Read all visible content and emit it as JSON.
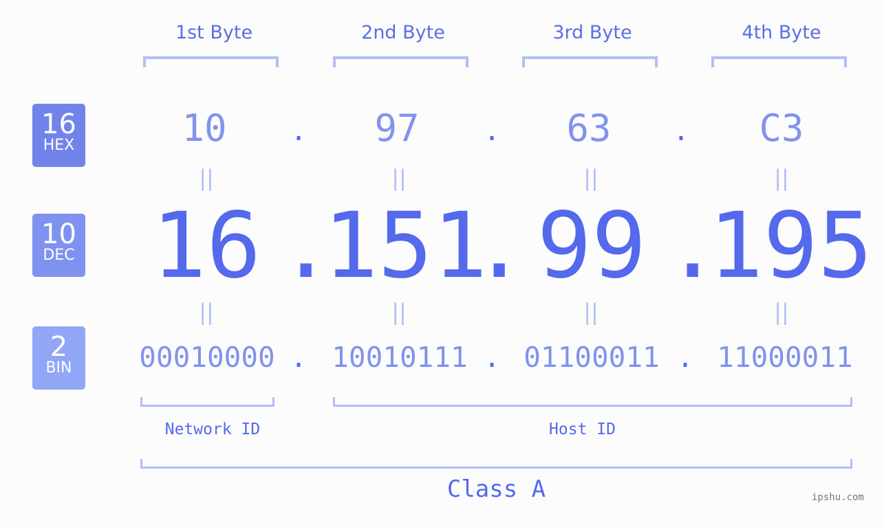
{
  "badges": {
    "hex": {
      "num": "16",
      "label": "HEX",
      "color": "#7283ea"
    },
    "dec": {
      "num": "10",
      "label": "DEC",
      "color": "#8092f0"
    },
    "bin": {
      "num": "2",
      "label": "BIN",
      "color": "#91a6f6"
    }
  },
  "byte_labels": [
    "1st Byte",
    "2nd Byte",
    "3rd Byte",
    "4th Byte"
  ],
  "hex_values": [
    "10",
    "97",
    "63",
    "C3"
  ],
  "dec_values": [
    "16",
    "151",
    "99",
    "195"
  ],
  "bin_values": [
    "00010000",
    "10010111",
    "01100011",
    "11000011"
  ],
  "separator": ".",
  "equals": "||",
  "network_label": "Network ID",
  "host_label": "Host ID",
  "class_label": "Class A",
  "watermark": "ipshu.com",
  "colors": {
    "primary": "#5469ec",
    "light": "#8292ee",
    "bracket": "#b2bef6",
    "background": "#fbfcfb"
  }
}
